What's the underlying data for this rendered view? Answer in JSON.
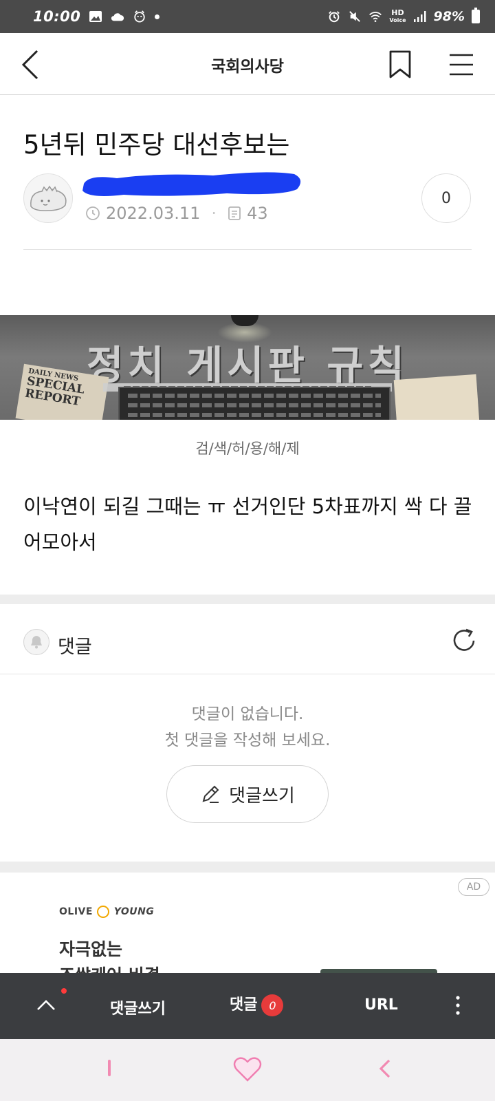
{
  "status_bar": {
    "time": "10:00",
    "hd_top": "HD",
    "hd_bottom": "Voice",
    "battery": "98%"
  },
  "header": {
    "title": "국회의사당",
    "back_icon": "chevron-left-icon",
    "bookmark_icon": "bookmark-icon",
    "menu_icon": "hamburger-menu-icon"
  },
  "post": {
    "title": "5년뒤 민주당 대선후보는",
    "date": "2022.03.11",
    "views": "43",
    "comment_count": "0",
    "banner": {
      "title": "정치 게시판 규칙",
      "paper_top": "DAILY NEWS",
      "paper_main": "SPECIAL REPORT"
    },
    "caption": "검/색/허/용/해/제",
    "body": " 이낙연이 되길 그때는 ㅠ 선거인단 5차표까지 싹 다 끌어모아서"
  },
  "comments": {
    "label": "댓글",
    "empty_line1": "댓글이 없습니다.",
    "empty_line2": "첫 댓글을 작성해 보세요.",
    "write_button": "댓글쓰기"
  },
  "ad": {
    "badge": "AD",
    "brand": "OLIVE",
    "brand2": "YOUNG",
    "line1": "자극없는",
    "line2": "조쌀케어 비결"
  },
  "toolbar": {
    "write": "댓글쓰기",
    "comments": "댓글",
    "comments_badge": "0",
    "url": "URL"
  },
  "colors": {
    "status_bar_bg": "#4a4a4a",
    "toolbar_bg": "#3b3d40",
    "badge_red": "#e73b3b",
    "nav_pink": "#f28ab2"
  }
}
